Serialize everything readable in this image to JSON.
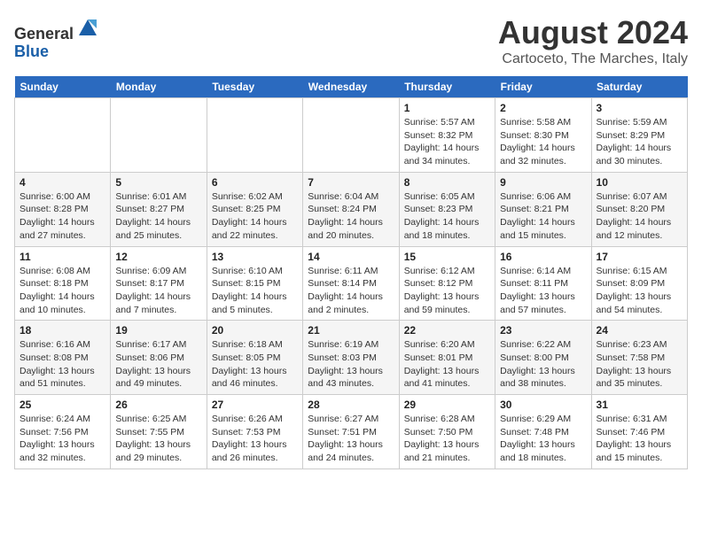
{
  "header": {
    "logo_line1": "General",
    "logo_line2": "Blue",
    "title": "August 2024",
    "subtitle": "Cartoceto, The Marches, Italy"
  },
  "calendar": {
    "days_of_week": [
      "Sunday",
      "Monday",
      "Tuesday",
      "Wednesday",
      "Thursday",
      "Friday",
      "Saturday"
    ],
    "weeks": [
      [
        {
          "date": "",
          "detail": ""
        },
        {
          "date": "",
          "detail": ""
        },
        {
          "date": "",
          "detail": ""
        },
        {
          "date": "",
          "detail": ""
        },
        {
          "date": "1",
          "detail": "Sunrise: 5:57 AM\nSunset: 8:32 PM\nDaylight: 14 hours\nand 34 minutes."
        },
        {
          "date": "2",
          "detail": "Sunrise: 5:58 AM\nSunset: 8:30 PM\nDaylight: 14 hours\nand 32 minutes."
        },
        {
          "date": "3",
          "detail": "Sunrise: 5:59 AM\nSunset: 8:29 PM\nDaylight: 14 hours\nand 30 minutes."
        }
      ],
      [
        {
          "date": "4",
          "detail": "Sunrise: 6:00 AM\nSunset: 8:28 PM\nDaylight: 14 hours\nand 27 minutes."
        },
        {
          "date": "5",
          "detail": "Sunrise: 6:01 AM\nSunset: 8:27 PM\nDaylight: 14 hours\nand 25 minutes."
        },
        {
          "date": "6",
          "detail": "Sunrise: 6:02 AM\nSunset: 8:25 PM\nDaylight: 14 hours\nand 22 minutes."
        },
        {
          "date": "7",
          "detail": "Sunrise: 6:04 AM\nSunset: 8:24 PM\nDaylight: 14 hours\nand 20 minutes."
        },
        {
          "date": "8",
          "detail": "Sunrise: 6:05 AM\nSunset: 8:23 PM\nDaylight: 14 hours\nand 18 minutes."
        },
        {
          "date": "9",
          "detail": "Sunrise: 6:06 AM\nSunset: 8:21 PM\nDaylight: 14 hours\nand 15 minutes."
        },
        {
          "date": "10",
          "detail": "Sunrise: 6:07 AM\nSunset: 8:20 PM\nDaylight: 14 hours\nand 12 minutes."
        }
      ],
      [
        {
          "date": "11",
          "detail": "Sunrise: 6:08 AM\nSunset: 8:18 PM\nDaylight: 14 hours\nand 10 minutes."
        },
        {
          "date": "12",
          "detail": "Sunrise: 6:09 AM\nSunset: 8:17 PM\nDaylight: 14 hours\nand 7 minutes."
        },
        {
          "date": "13",
          "detail": "Sunrise: 6:10 AM\nSunset: 8:15 PM\nDaylight: 14 hours\nand 5 minutes."
        },
        {
          "date": "14",
          "detail": "Sunrise: 6:11 AM\nSunset: 8:14 PM\nDaylight: 14 hours\nand 2 minutes."
        },
        {
          "date": "15",
          "detail": "Sunrise: 6:12 AM\nSunset: 8:12 PM\nDaylight: 13 hours\nand 59 minutes."
        },
        {
          "date": "16",
          "detail": "Sunrise: 6:14 AM\nSunset: 8:11 PM\nDaylight: 13 hours\nand 57 minutes."
        },
        {
          "date": "17",
          "detail": "Sunrise: 6:15 AM\nSunset: 8:09 PM\nDaylight: 13 hours\nand 54 minutes."
        }
      ],
      [
        {
          "date": "18",
          "detail": "Sunrise: 6:16 AM\nSunset: 8:08 PM\nDaylight: 13 hours\nand 51 minutes."
        },
        {
          "date": "19",
          "detail": "Sunrise: 6:17 AM\nSunset: 8:06 PM\nDaylight: 13 hours\nand 49 minutes."
        },
        {
          "date": "20",
          "detail": "Sunrise: 6:18 AM\nSunset: 8:05 PM\nDaylight: 13 hours\nand 46 minutes."
        },
        {
          "date": "21",
          "detail": "Sunrise: 6:19 AM\nSunset: 8:03 PM\nDaylight: 13 hours\nand 43 minutes."
        },
        {
          "date": "22",
          "detail": "Sunrise: 6:20 AM\nSunset: 8:01 PM\nDaylight: 13 hours\nand 41 minutes."
        },
        {
          "date": "23",
          "detail": "Sunrise: 6:22 AM\nSunset: 8:00 PM\nDaylight: 13 hours\nand 38 minutes."
        },
        {
          "date": "24",
          "detail": "Sunrise: 6:23 AM\nSunset: 7:58 PM\nDaylight: 13 hours\nand 35 minutes."
        }
      ],
      [
        {
          "date": "25",
          "detail": "Sunrise: 6:24 AM\nSunset: 7:56 PM\nDaylight: 13 hours\nand 32 minutes."
        },
        {
          "date": "26",
          "detail": "Sunrise: 6:25 AM\nSunset: 7:55 PM\nDaylight: 13 hours\nand 29 minutes."
        },
        {
          "date": "27",
          "detail": "Sunrise: 6:26 AM\nSunset: 7:53 PM\nDaylight: 13 hours\nand 26 minutes."
        },
        {
          "date": "28",
          "detail": "Sunrise: 6:27 AM\nSunset: 7:51 PM\nDaylight: 13 hours\nand 24 minutes."
        },
        {
          "date": "29",
          "detail": "Sunrise: 6:28 AM\nSunset: 7:50 PM\nDaylight: 13 hours\nand 21 minutes."
        },
        {
          "date": "30",
          "detail": "Sunrise: 6:29 AM\nSunset: 7:48 PM\nDaylight: 13 hours\nand 18 minutes."
        },
        {
          "date": "31",
          "detail": "Sunrise: 6:31 AM\nSunset: 7:46 PM\nDaylight: 13 hours\nand 15 minutes."
        }
      ]
    ]
  }
}
